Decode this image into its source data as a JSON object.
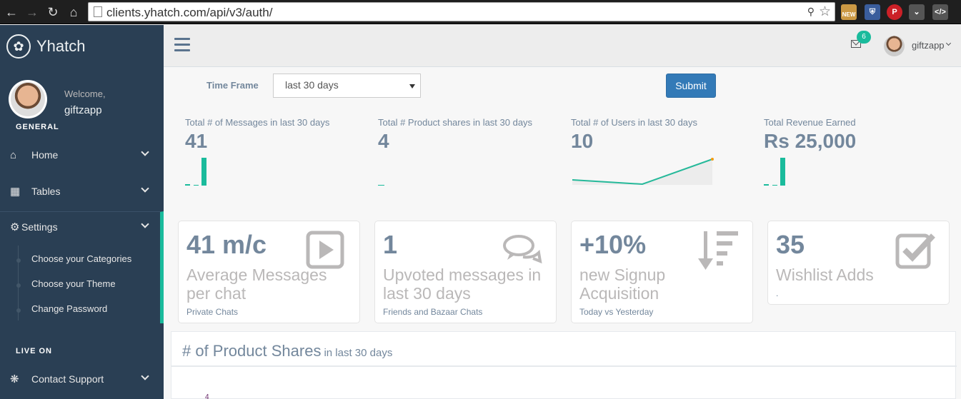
{
  "browser": {
    "url": "clients.yhatch.com/api/v3/auth/",
    "ext_new_label": "NEW"
  },
  "brand": {
    "name": "Yhatch"
  },
  "profile": {
    "welcome": "Welcome,",
    "name": "giftzapp"
  },
  "sidebar": {
    "general_title": "GENERAL",
    "live_title": "LIVE ON",
    "items": [
      {
        "label": "Home",
        "icon": "home-icon"
      },
      {
        "label": "Tables",
        "icon": "table-icon"
      },
      {
        "label": "Settings",
        "icon": "gear-icon"
      },
      {
        "label": "Contact Support",
        "icon": "bug-icon"
      }
    ],
    "settings_sub": [
      {
        "label": "Choose your Categories"
      },
      {
        "label": "Choose your Theme"
      },
      {
        "label": "Change Password"
      }
    ]
  },
  "topnav": {
    "mail_count": "6",
    "user_name": "giftzapp"
  },
  "filter": {
    "label": "Time Frame",
    "selected": "last 30 days",
    "submit": "Submit"
  },
  "tiles": [
    {
      "title": "Total # of Messages in last 30 days",
      "count": "41"
    },
    {
      "title": "Total # Product shares in last 30 days",
      "count": "4"
    },
    {
      "title": "Total # of Users in last 30 days",
      "count": "10"
    },
    {
      "title": "Total Revenue Earned",
      "count": "Rs 25,000"
    }
  ],
  "stats": [
    {
      "number": "41 m/c",
      "label": "Average Messages per chat",
      "sub": "Private Chats",
      "icon": "play-icon"
    },
    {
      "number": "1",
      "label": "Upvoted messages in last 30 days",
      "sub": "Friends and Bazaar Chats",
      "icon": "comments-icon"
    },
    {
      "number": "+10%",
      "label": "new Signup Acquisition",
      "sub": "Today vs Yesterday",
      "icon": "sort-amount-desc-icon"
    },
    {
      "number": "35",
      "label": "Wishlist Adds",
      "sub": ".",
      "icon": "check-square-icon"
    }
  ],
  "panel": {
    "title": "# of Product Shares",
    "subtitle": "in last 30 days",
    "first_tick": "4"
  },
  "colors": {
    "sidebar_bg": "#2A3F54",
    "accent": "#1ABB9C",
    "primary_button": "#337AB7",
    "text": "#73879C"
  }
}
